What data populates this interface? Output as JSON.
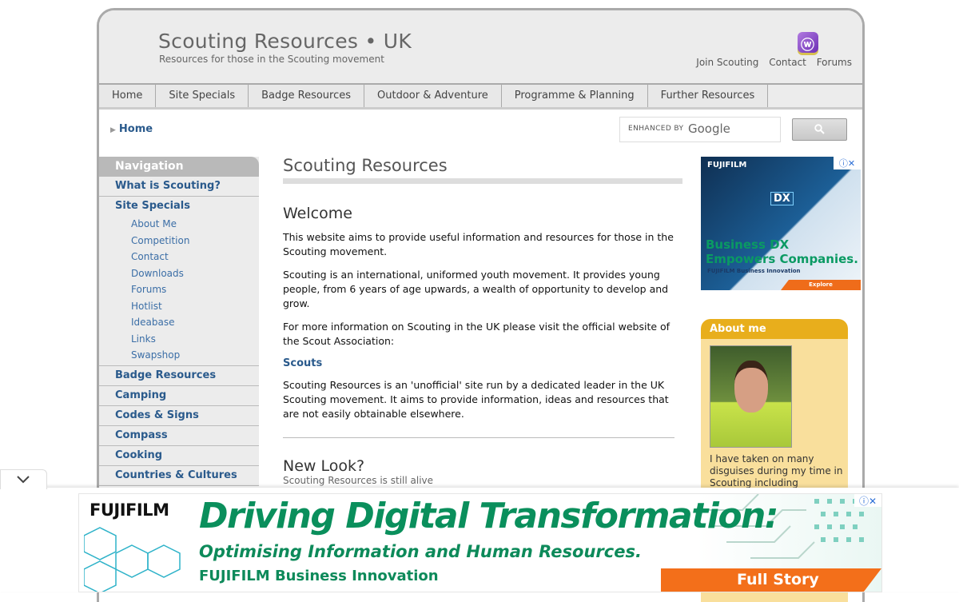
{
  "header": {
    "title": "Scouting Resources • UK",
    "tagline": "Resources for those in the Scouting movement",
    "rss_icon": "rss-icon",
    "links": [
      "Join Scouting",
      "Contact",
      "Forums"
    ]
  },
  "mainnav": [
    "Home",
    "Site Specials",
    "Badge Resources",
    "Outdoor & Adventure",
    "Programme & Planning",
    "Further Resources"
  ],
  "breadcrumb": {
    "label": "Home"
  },
  "search": {
    "label": "ENHANCED BY",
    "brand": "Google"
  },
  "sidebar": {
    "heading": "Navigation",
    "item_what": "What is Scouting?",
    "group_label": "Site Specials",
    "sub": [
      "About Me",
      "Competition",
      "Contact",
      "Downloads",
      "Forums",
      "Hotlist",
      "Ideabase",
      "Links",
      "Swapshop"
    ],
    "items": [
      "Badge Resources",
      "Camping",
      "Codes & Signs",
      "Compass",
      "Cooking",
      "Countries & Cultures"
    ]
  },
  "content": {
    "title": "Scouting Resources",
    "welcome": "Welcome",
    "p1": "This website aims to provide useful information and resources for those in the Scouting movement.",
    "p2": "Scouting is an international, uniformed youth movement. It provides young people, from 6 years of age upwards, a wealth of opportunity to develop and grow.",
    "p3": "For more information on Scouting in the UK please visit the official website of the Scout Association:",
    "link": "Scouts",
    "p4": "Scouting Resources is an 'unofficial' site run by a dedicated leader in the UK Scouting movement. It aims to provide information, ideas and resources that are not easily obtainable elsewhere.",
    "new_title": "New Look?",
    "new_sub": "Scouting Resources is still alive"
  },
  "ad_right": {
    "brand": "FUJIFILM",
    "dx": "DX",
    "headline": "Business DX Empowers Companies.",
    "small": "FUJIFILM Business Innovation",
    "cta": "Explore"
  },
  "about": {
    "heading": "About me",
    "bio": "I have taken on many disguises during my time in Scouting including"
  },
  "ad_bottom": {
    "brand": "FUJIFILM",
    "line1": "Driving Digital Transformation:",
    "line2": "Optimising Information and Human Resources.",
    "line3": "FUJIFILM Business Innovation",
    "cta": "Full Story"
  },
  "colors": {
    "link": "#2a5a8c",
    "about_header": "#e8ae1c",
    "ad_green": "#0a8f5c",
    "ad_orange": "#f36f1a"
  }
}
